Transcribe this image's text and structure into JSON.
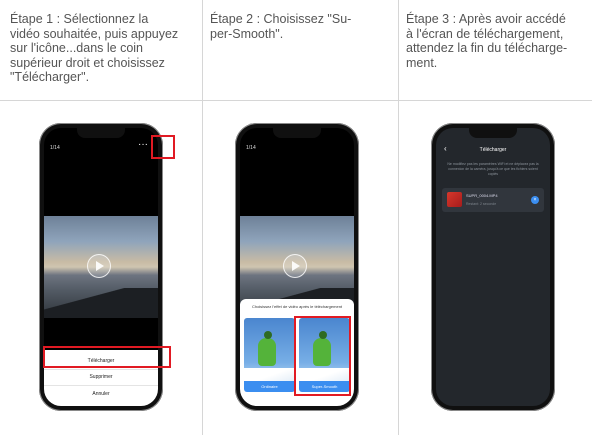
{
  "steps": [
    {
      "lines": [
        "Étape 1 : Sélectionnez la",
        "vidéo souhaitée, puis appuyez",
        "sur l'icône...dans le coin",
        "supérieur droit et choisissez",
        "\"Télécharger\"."
      ]
    },
    {
      "lines": [
        "Étape 2 : Choisissez \"Su-",
        "per-Smooth\"."
      ]
    },
    {
      "lines": [
        "Étape 3 : Après avoir accédé",
        "à l'écran de téléchargement,",
        "attendez la fin du télécharge-",
        "ment."
      ]
    }
  ],
  "phone1": {
    "counter": "1/14",
    "more_icon": "···",
    "menu": {
      "download": "Télécharger",
      "delete": "Supprimer",
      "cancel": "Annuler"
    }
  },
  "phone2": {
    "counter": "1/14",
    "panel_title": "Choisissez l'effet de vidéo après le téléchargement",
    "option_ordinary": "Ordinaire",
    "option_supersmooth": "Super-Smooth"
  },
  "phone3": {
    "title": "Télécharger",
    "note": "Ne modifiez pas les paramètres WiFi et ne déplacez pas la connexion de la caméra, jusqu'à ce que les fichiers soient copiés",
    "file_name": "SUPR_0004.MP4",
    "file_status": "Restant: 2 seconde",
    "icons": {
      "back": "back-arrow",
      "cancel": "close-icon"
    }
  },
  "colors": {
    "highlight": "#e11a23",
    "accent": "#3b8ef0"
  }
}
